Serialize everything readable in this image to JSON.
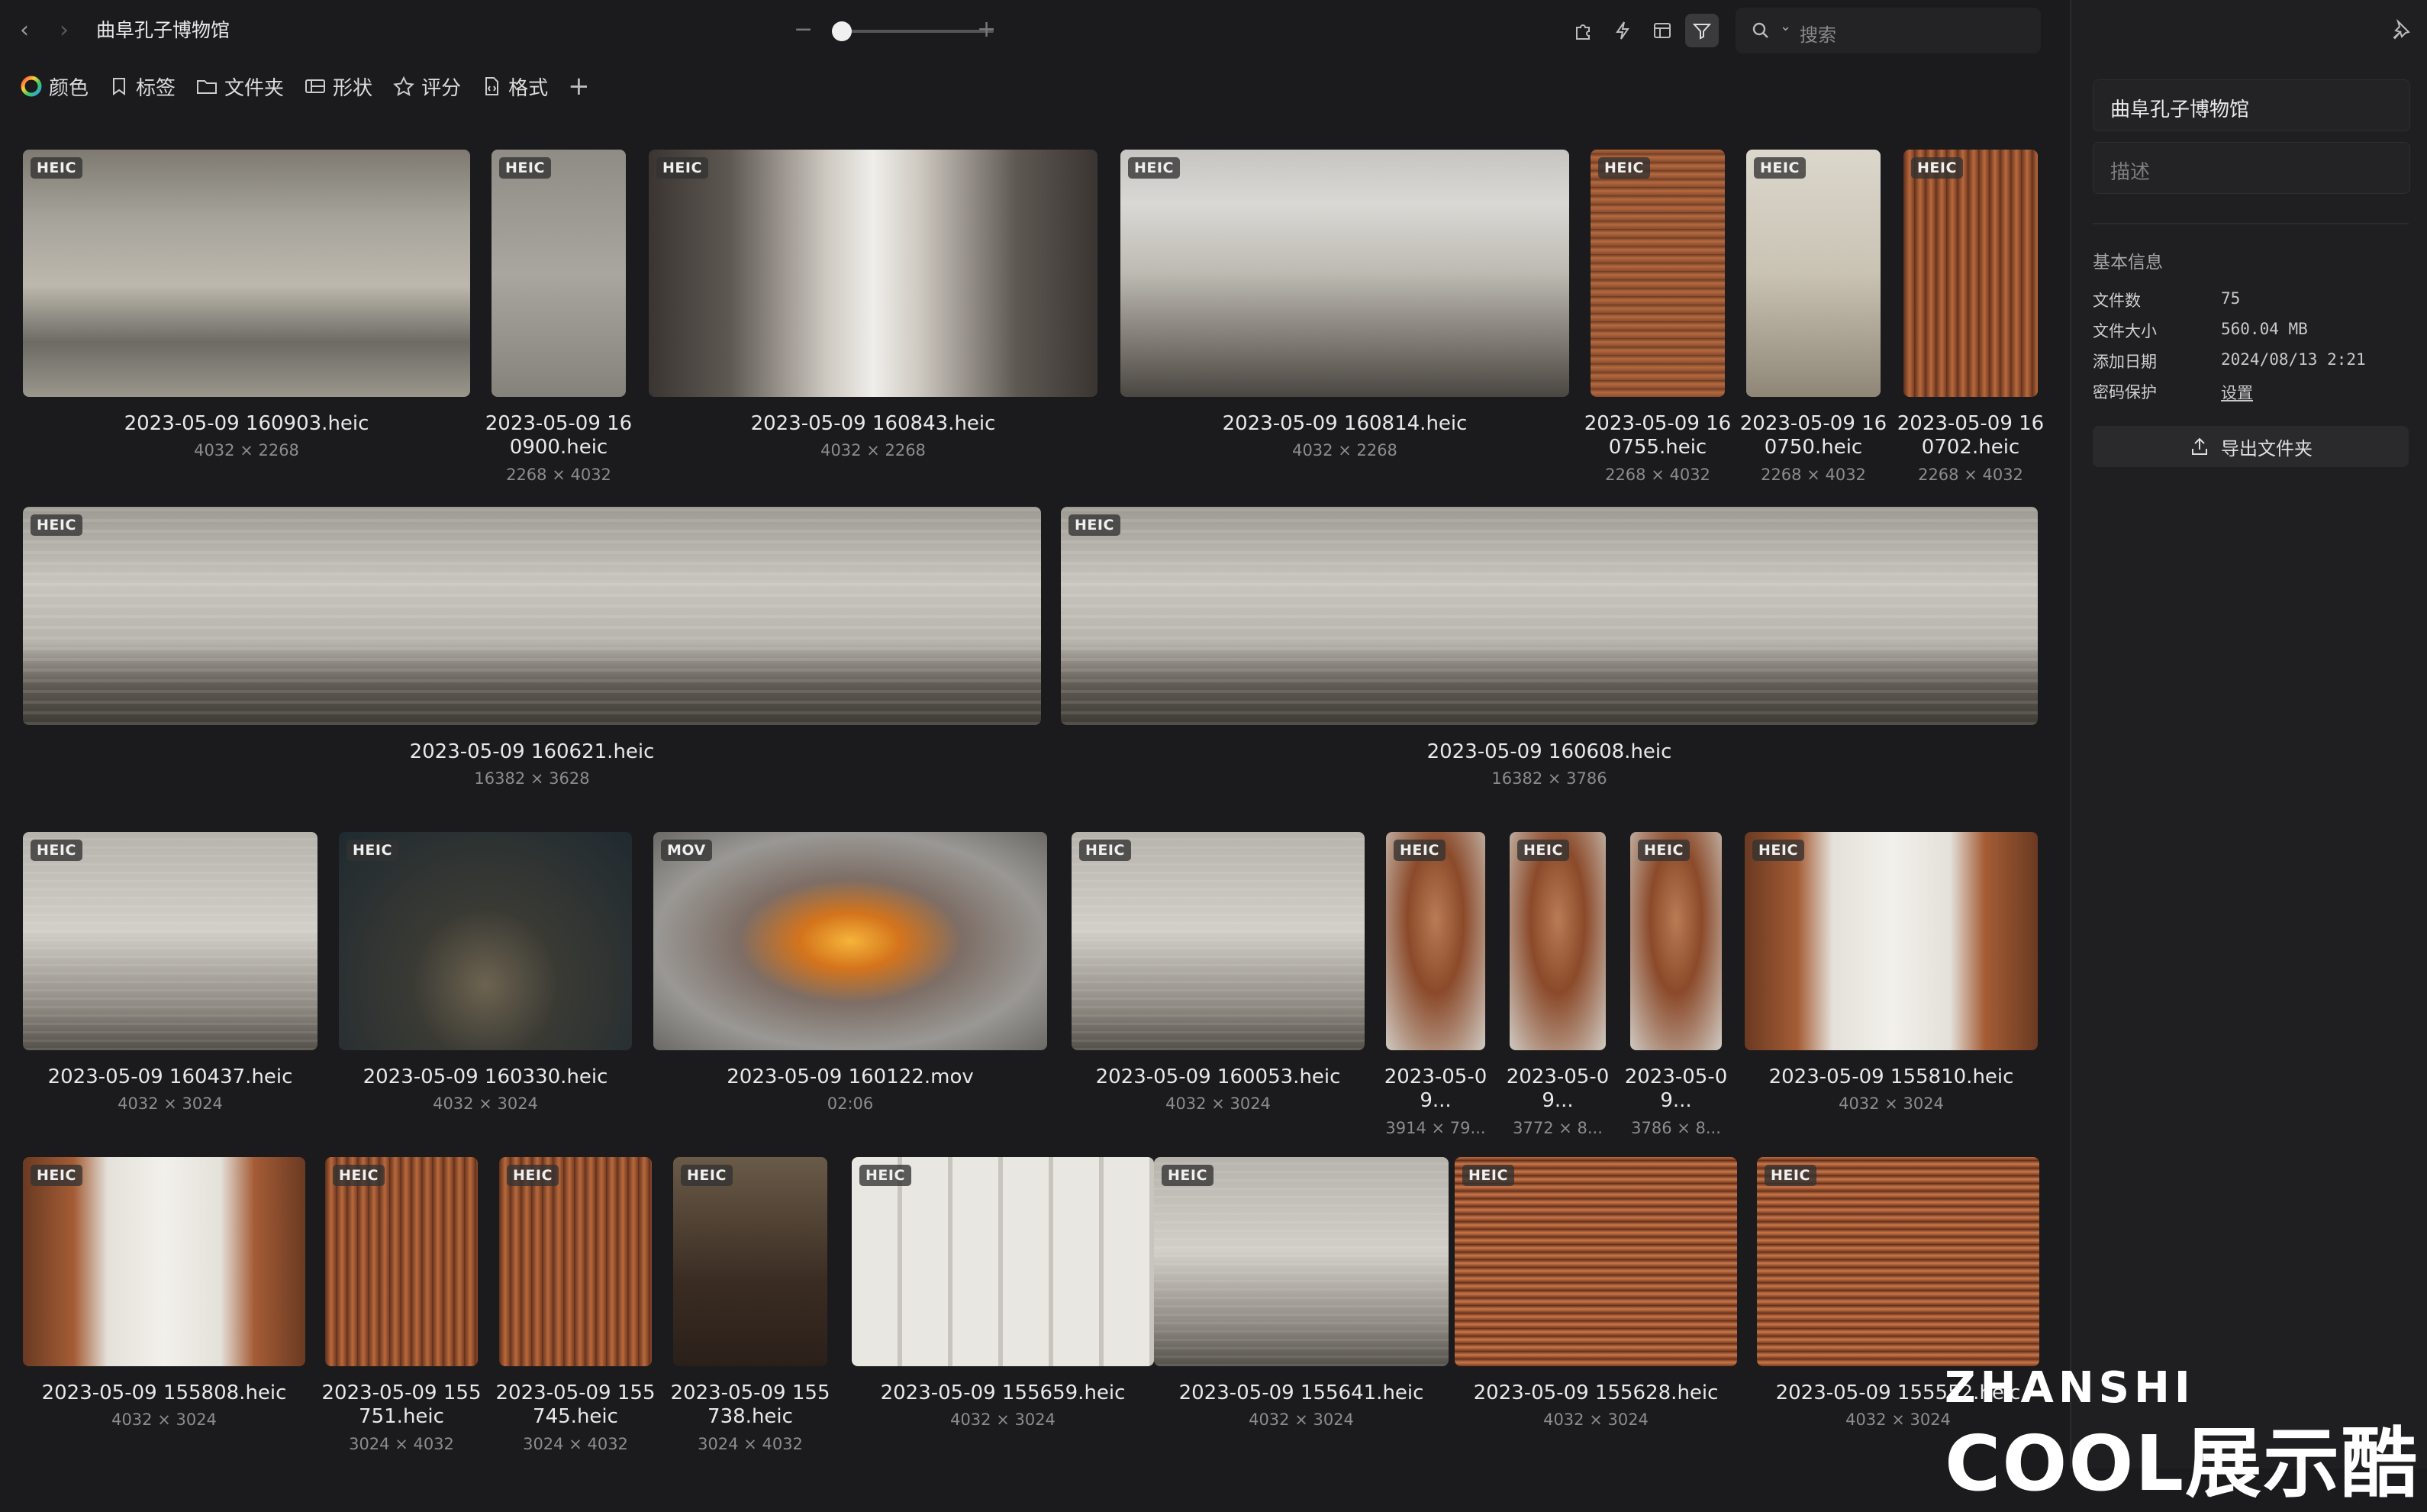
{
  "app": {
    "title": "曲阜孔子博物馆"
  },
  "search": {
    "placeholder": "搜索"
  },
  "zoom": {
    "level": 0.05
  },
  "filters": [
    "颜色",
    "标签",
    "文件夹",
    "形状",
    "评分",
    "格式"
  ],
  "rows": [
    {
      "items": [
        {
          "badge": "HEIC",
          "name": "2023-05-09 160903.heic",
          "dims": "4032 × 2268",
          "style": "t-hall"
        },
        {
          "badge": "HEIC",
          "name": "2023-05-09 160900.heic",
          "dims": "2268 × 4032",
          "style": "t-stone"
        },
        {
          "badge": "HEIC",
          "name": "2023-05-09 160843.heic",
          "dims": "4032 × 2268",
          "style": "t-glow"
        },
        {
          "badge": "HEIC",
          "name": "2023-05-09 160814.heic",
          "dims": "4032 × 2268",
          "style": "t-dome"
        },
        {
          "badge": "HEIC",
          "name": "2023-05-09 160755.heic",
          "dims": "2268 × 4032",
          "style": "t-wood"
        },
        {
          "badge": "HEIC",
          "name": "2023-05-09 160750.heic",
          "dims": "2268 × 4032",
          "style": "t-sign"
        },
        {
          "badge": "HEIC",
          "name": "2023-05-09 160702.heic",
          "dims": "2268 × 4032",
          "style": "t-tower"
        }
      ]
    },
    {
      "items": [
        {
          "badge": "HEIC",
          "name": "2023-05-09 160621.heic",
          "dims": "16382 × 3628",
          "style": "t-pano"
        },
        {
          "badge": "HEIC",
          "name": "2023-05-09 160608.heic",
          "dims": "16382 × 3786",
          "style": "t-pano"
        }
      ]
    },
    {
      "items": [
        {
          "badge": "HEIC",
          "name": "2023-05-09 160437.heic",
          "dims": "4032 × 3024",
          "style": "t-wall"
        },
        {
          "badge": "HEIC",
          "name": "2023-05-09 160330.heic",
          "dims": "4032 × 3024",
          "style": "t-confucius"
        },
        {
          "badge": "MOV",
          "name": "2023-05-09 160122.mov",
          "dims": "02:06",
          "style": "t-fire"
        },
        {
          "badge": "HEIC",
          "name": "2023-05-09 160053.heic",
          "dims": "4032 × 3024",
          "style": "t-wall"
        },
        {
          "badge": "HEIC",
          "name": "2023-05-09...",
          "dims": "3914 × 79...",
          "style": "t-curve"
        },
        {
          "badge": "HEIC",
          "name": "2023-05-09...",
          "dims": "3772 × 8...",
          "style": "t-curve"
        },
        {
          "badge": "HEIC",
          "name": "2023-05-09...",
          "dims": "3786 × 8...",
          "style": "t-curve"
        },
        {
          "badge": "HEIC",
          "name": "2023-05-09 155810.heic",
          "dims": "4032 × 3024",
          "style": "t-gate"
        }
      ]
    },
    {
      "items": [
        {
          "badge": "HEIC",
          "name": "2023-05-09 155808.heic",
          "dims": "4032 × 3024",
          "style": "t-gate"
        },
        {
          "badge": "HEIC",
          "name": "2023-05-09 155751.heic",
          "dims": "3024 × 4032",
          "style": "t-tower"
        },
        {
          "badge": "HEIC",
          "name": "2023-05-09 155745.heic",
          "dims": "3024 × 4032",
          "style": "t-tower"
        },
        {
          "badge": "HEIC",
          "name": "2023-05-09 155738.heic",
          "dims": "3024 × 4032",
          "style": "t-dark"
        },
        {
          "badge": "HEIC",
          "name": "2023-05-09 155659.heic",
          "dims": "4032 × 3024",
          "style": "t-white"
        },
        {
          "badge": "HEIC",
          "name": "2023-05-09 155641.heic",
          "dims": "4032 × 3024",
          "style": "t-wall"
        },
        {
          "badge": "HEIC",
          "name": "2023-05-09 155628.heic",
          "dims": "4032 × 3024",
          "style": "t-redshelf"
        },
        {
          "badge": "HEIC",
          "name": "2023-05-09 155552.heic",
          "dims": "4032 × 3024",
          "style": "t-redshelf"
        }
      ]
    }
  ],
  "sidebar": {
    "name": "曲阜孔子博物馆",
    "desc_placeholder": "描述",
    "section": "基本信息",
    "info": [
      {
        "label": "文件数",
        "value": "75"
      },
      {
        "label": "文件大小",
        "value": "560.04 MB"
      },
      {
        "label": "添加日期",
        "value": "2024/08/13 2:21"
      },
      {
        "label": "密码保护",
        "value": "设置"
      }
    ],
    "export_label": "导出文件夹"
  },
  "watermark": {
    "line1": "ZHANSHI",
    "line2": "COOL展示酷"
  }
}
